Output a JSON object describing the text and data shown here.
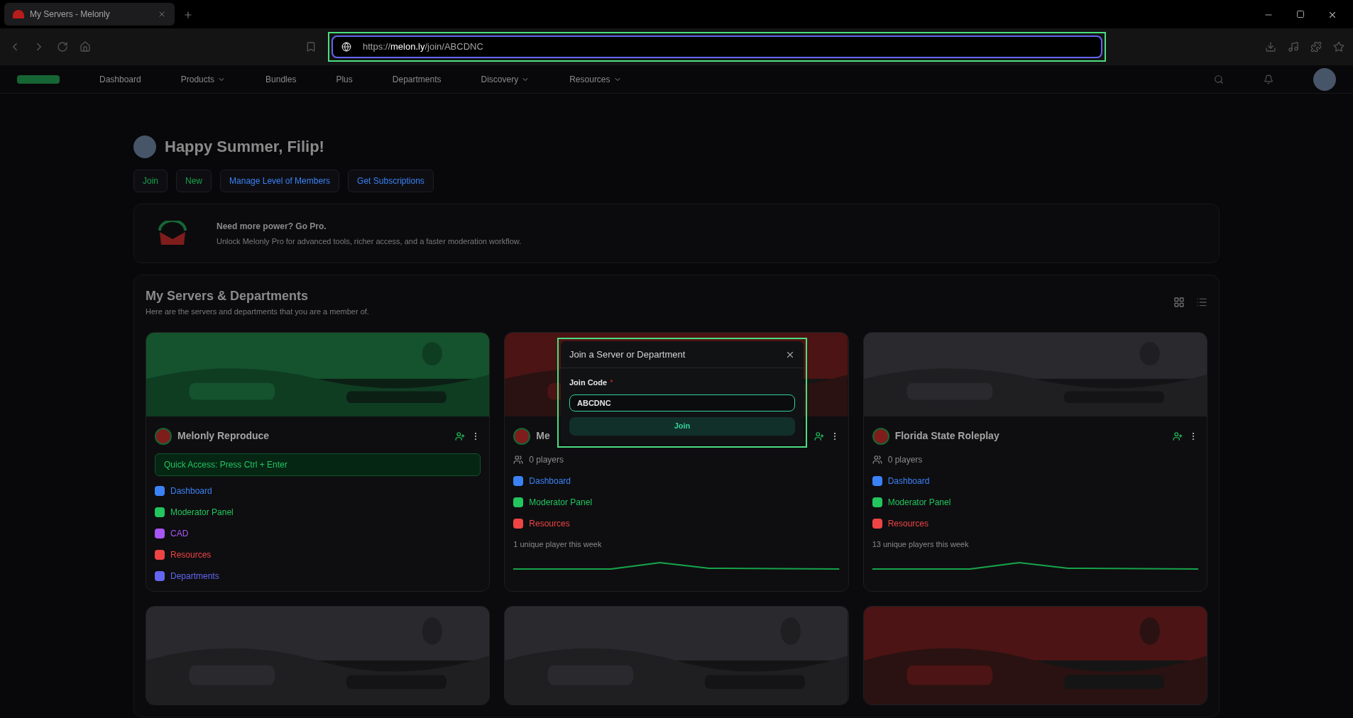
{
  "browser": {
    "tab_title": "My Servers - Melonly",
    "url": {
      "scheme": "https://",
      "host": "melon.ly",
      "path": "/join/ABCDNC"
    }
  },
  "nav": {
    "items": [
      {
        "label": "Dashboard",
        "has_caret": false
      },
      {
        "label": "Products",
        "has_caret": true
      },
      {
        "label": "Bundles",
        "has_caret": false
      },
      {
        "label": "Plus",
        "has_caret": false
      },
      {
        "label": "Departments",
        "has_caret": false
      },
      {
        "label": "Discovery",
        "has_caret": true
      },
      {
        "label": "Resources",
        "has_caret": true
      }
    ]
  },
  "greeting": "Happy Summer, Filip!",
  "actions": [
    {
      "label": "Join",
      "color": "#16a34a"
    },
    {
      "label": "New",
      "color": "#16a34a"
    },
    {
      "label": "Manage Level of Members",
      "color": "#3b82f6"
    },
    {
      "label": "Get Subscriptions",
      "color": "#3b82f6"
    }
  ],
  "promo": {
    "title": "Need more power? Go Pro.",
    "text": "Unlock Melonly Pro for advanced tools, richer access, and a faster moderation workflow."
  },
  "servers": {
    "title": "My Servers & Departments",
    "subtitle": "Here are the servers and departments that you are a member of.",
    "cards": [
      {
        "name": "Melonly Reproduce",
        "quick_access": "Quick Access: Press Ctrl + Enter",
        "links": [
          {
            "label": "Dashboard",
            "color": "#3b82f6"
          },
          {
            "label": "Moderator Panel",
            "color": "#22c55e"
          },
          {
            "label": "CAD",
            "color": "#a855f7"
          },
          {
            "label": "Resources",
            "color": "#ef4444"
          },
          {
            "label": "Departments",
            "color": "#6366f1"
          }
        ]
      },
      {
        "name": "Me",
        "players": "0 players",
        "links": [
          {
            "label": "Dashboard",
            "color": "#3b82f6"
          },
          {
            "label": "Moderator Panel",
            "color": "#22c55e"
          },
          {
            "label": "Resources",
            "color": "#ef4444"
          }
        ],
        "stats": "1 unique player this week"
      },
      {
        "name": "Florida State Roleplay",
        "players": "0 players",
        "links": [
          {
            "label": "Dashboard",
            "color": "#3b82f6"
          },
          {
            "label": "Moderator Panel",
            "color": "#22c55e"
          },
          {
            "label": "Resources",
            "color": "#ef4444"
          }
        ],
        "stats": "13 unique players this week"
      }
    ]
  },
  "dialog": {
    "title": "Join a Server or Department",
    "field_label": "Join Code",
    "required_marker": "*",
    "value": "ABCDNC",
    "button": "Join"
  }
}
